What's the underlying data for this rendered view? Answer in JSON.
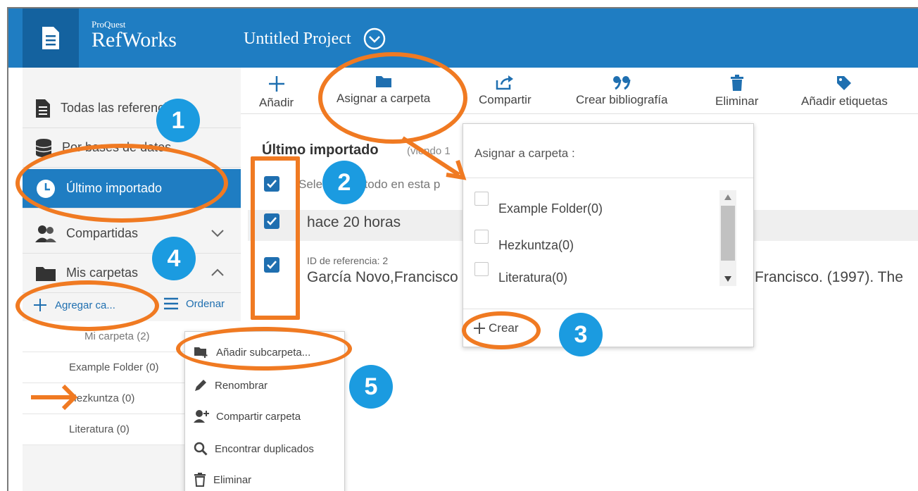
{
  "header": {
    "brand_small": "ProQuest",
    "brand_name": "RefWorks",
    "project_title": "Untitled Project",
    "color": "#1f7dc2"
  },
  "sidebar": {
    "items": [
      {
        "label": "Todas las referencias",
        "icon": "document-icon"
      },
      {
        "label": "Por bases de datos",
        "icon": "database-icon"
      },
      {
        "label": "Último importado",
        "icon": "clock-icon",
        "active": true
      },
      {
        "label": "Compartidas",
        "icon": "users-icon"
      },
      {
        "label": "Mis carpetas",
        "icon": "folder-icon"
      }
    ],
    "add_folder_label": "Agregar ca...",
    "sort_label": "Ordenar",
    "folders": [
      {
        "label": "Mi carpeta (2)"
      },
      {
        "label": "Example Folder (0)"
      },
      {
        "label": "Hezkuntza (0)"
      },
      {
        "label": "Literatura (0)"
      }
    ]
  },
  "toolbar": {
    "items": [
      {
        "label": "Añadir",
        "icon": "plus-icon"
      },
      {
        "label": "Asignar a carpeta",
        "icon": "folder-icon"
      },
      {
        "label": "Compartir",
        "icon": "share-icon"
      },
      {
        "label": "Crear bibliografía",
        "icon": "quote-icon"
      },
      {
        "label": "Eliminar",
        "icon": "trash-icon"
      },
      {
        "label": "Añadir etiquetas",
        "icon": "tag-icon"
      }
    ]
  },
  "content": {
    "title": "Último importado",
    "title_sub": "(viendo 1",
    "select_all": "Seleccionar todo en esta p",
    "date_group": "hace 20 horas",
    "reference": {
      "id_label": "ID de referencia: 2",
      "author": "García Novo,Francisco",
      "citation": "Francisco. (1997). The"
    }
  },
  "assign_popup": {
    "title": "Asignar a carpeta :",
    "folders": [
      "Example Folder(0)",
      "Hezkuntza(0)",
      "Literatura(0)"
    ],
    "create_label": "Crear"
  },
  "context_menu": {
    "items": [
      {
        "label": "Añadir subcarpeta...",
        "icon": "add-folder-icon"
      },
      {
        "label": "Renombrar",
        "icon": "pencil-icon"
      },
      {
        "label": "Compartir carpeta",
        "icon": "add-user-icon"
      },
      {
        "label": "Encontrar duplicados",
        "icon": "search-icon"
      },
      {
        "label": "Eliminar",
        "icon": "trash-icon"
      }
    ]
  },
  "annotations": {
    "step_numbers": [
      "1",
      "2",
      "3",
      "4",
      "5"
    ],
    "ring_color": "#f07a22",
    "badge_color": "#1b9be0"
  }
}
